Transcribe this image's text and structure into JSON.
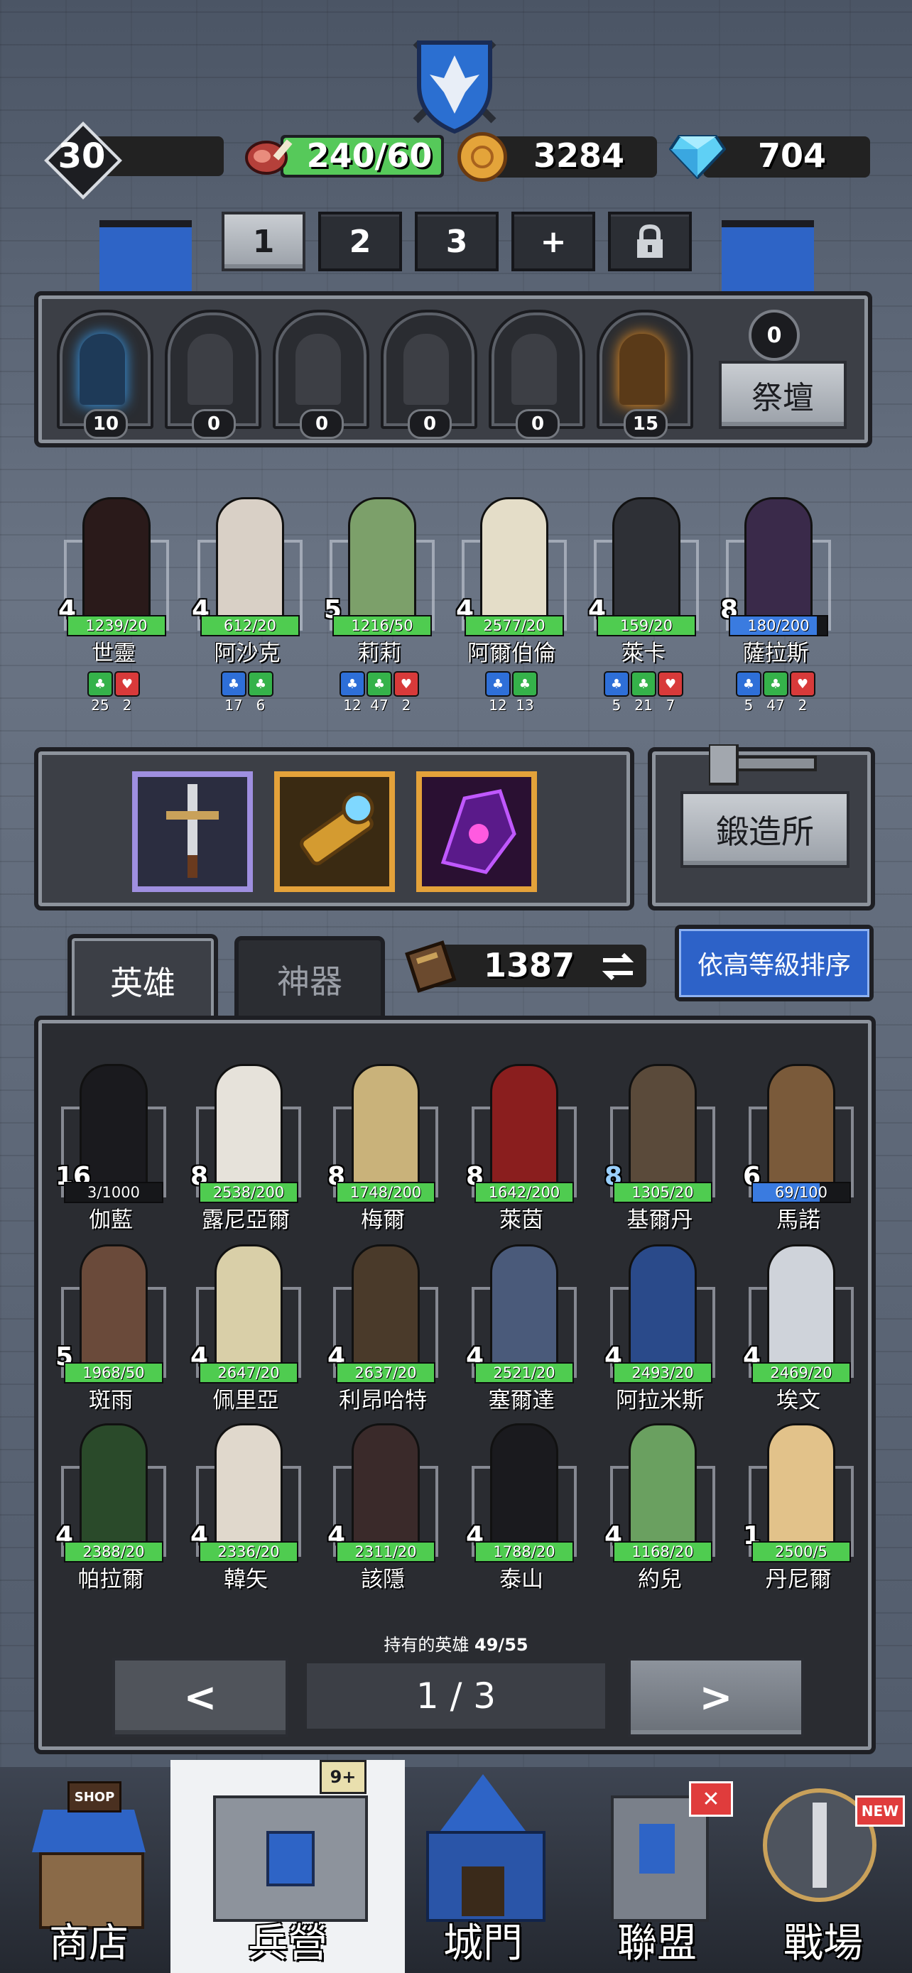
{
  "header": {
    "player_level": "30",
    "meat": "240/60",
    "gold": "3284",
    "gems": "704"
  },
  "team_tabs": [
    "1",
    "2",
    "3",
    "+"
  ],
  "altar": {
    "statues": [
      "10",
      "0",
      "0",
      "0",
      "0",
      "15"
    ],
    "count": "0",
    "button_label": "祭壇"
  },
  "team": [
    {
      "name": "世靈",
      "level": "4",
      "xp": "1239/20",
      "fill": 1.0,
      "stats": [
        [
          "green",
          "25"
        ],
        [
          "red",
          "2"
        ]
      ]
    },
    {
      "name": "阿沙克",
      "level": "4",
      "xp": "612/20",
      "fill": 1.0,
      "stats": [
        [
          "blue",
          "17"
        ],
        [
          "green",
          "6"
        ]
      ]
    },
    {
      "name": "莉莉",
      "level": "5",
      "xp": "1216/50",
      "fill": 1.0,
      "stats": [
        [
          "blue",
          "12"
        ],
        [
          "green",
          "47"
        ],
        [
          "red",
          "2"
        ]
      ]
    },
    {
      "name": "阿爾伯倫",
      "level": "4",
      "xp": "2577/20",
      "fill": 1.0,
      "stats": [
        [
          "blue",
          "12"
        ],
        [
          "green",
          "13"
        ]
      ]
    },
    {
      "name": "萊卡",
      "level": "4",
      "xp": "159/20",
      "fill": 1.0,
      "stats": [
        [
          "blue",
          "5"
        ],
        [
          "green",
          "21"
        ],
        [
          "red",
          "7"
        ]
      ]
    },
    {
      "name": "薩拉斯",
      "level": "8",
      "xp": "180/200",
      "fill": 0.9,
      "stats": [
        [
          "blue",
          "5"
        ],
        [
          "green",
          "47"
        ],
        [
          "red",
          "2"
        ]
      ]
    }
  ],
  "forge": {
    "button_label": "鍛造所"
  },
  "hero_tabs": {
    "heroes": "英雄",
    "artifacts": "神器"
  },
  "books": "1387",
  "sort_label": "依高等級排序",
  "roster": [
    {
      "name": "伽藍",
      "level": "16",
      "xp": "3/1000",
      "fill": 0.0
    },
    {
      "name": "露尼亞爾",
      "level": "8",
      "xp": "2538/200",
      "fill": 1.0
    },
    {
      "name": "梅爾",
      "level": "8",
      "xp": "1748/200",
      "fill": 1.0
    },
    {
      "name": "萊茵",
      "level": "8",
      "xp": "1642/200",
      "fill": 1.0
    },
    {
      "name": "基爾丹",
      "level": "8",
      "xp": "1305/20",
      "fill": 1.0
    },
    {
      "name": "馬諾",
      "level": "6",
      "xp": "69/100",
      "fill": 0.69
    },
    {
      "name": "斑雨",
      "level": "5",
      "xp": "1968/50",
      "fill": 1.0
    },
    {
      "name": "佩里亞",
      "level": "4",
      "xp": "2647/20",
      "fill": 1.0
    },
    {
      "name": "利昂哈特",
      "level": "4",
      "xp": "2637/20",
      "fill": 1.0
    },
    {
      "name": "塞爾達",
      "level": "4",
      "xp": "2521/20",
      "fill": 1.0
    },
    {
      "name": "阿拉米斯",
      "level": "4",
      "xp": "2493/20",
      "fill": 1.0
    },
    {
      "name": "埃文",
      "level": "4",
      "xp": "2469/20",
      "fill": 1.0
    },
    {
      "name": "帕拉爾",
      "level": "4",
      "xp": "2388/20",
      "fill": 1.0
    },
    {
      "name": "韓矢",
      "level": "4",
      "xp": "2336/20",
      "fill": 1.0
    },
    {
      "name": "該隱",
      "level": "4",
      "xp": "2311/20",
      "fill": 1.0
    },
    {
      "name": "泰山",
      "level": "4",
      "xp": "1788/20",
      "fill": 1.0
    },
    {
      "name": "約兒",
      "level": "4",
      "xp": "1168/20",
      "fill": 1.0
    },
    {
      "name": "丹尼爾",
      "level": "1",
      "xp": "2500/5",
      "fill": 1.0
    }
  ],
  "owned_label": "持有的英雄",
  "owned_count": "49/55",
  "pagination": {
    "prev": "<",
    "page": "1 / 3",
    "next": ">"
  },
  "nav": {
    "shop": "商店",
    "shop_sign": "SHOP",
    "barracks": "兵營",
    "barracks_badge": "9+",
    "gate": "城門",
    "alliance": "聯盟",
    "arena": "戰場",
    "new_badge": "NEW"
  },
  "colors": {
    "xp_green": "#4fcc50",
    "xp_blue": "#3a7be0",
    "sort_btn": "#2d62c8"
  }
}
